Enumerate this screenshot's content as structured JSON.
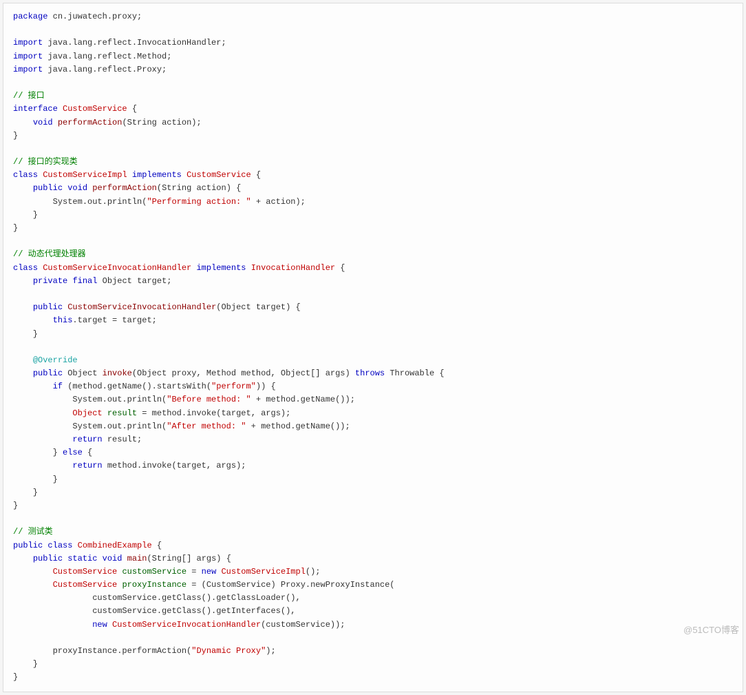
{
  "watermark": "@51CTO博客",
  "code": {
    "tokens": [
      [
        [
          "kw",
          "package"
        ],
        [
          "p",
          " cn.juwatech.proxy;"
        ]
      ],
      [
        [
          "p",
          ""
        ]
      ],
      [
        [
          "kw",
          "import"
        ],
        [
          "p",
          " java.lang.reflect.InvocationHandler;"
        ]
      ],
      [
        [
          "kw",
          "import"
        ],
        [
          "p",
          " java.lang.reflect.Method;"
        ]
      ],
      [
        [
          "kw",
          "import"
        ],
        [
          "p",
          " java.lang.reflect.Proxy;"
        ]
      ],
      [
        [
          "p",
          ""
        ]
      ],
      [
        [
          "cmt",
          "// 接口"
        ]
      ],
      [
        [
          "kw",
          "interface"
        ],
        [
          "p",
          " "
        ],
        [
          "type",
          "CustomService"
        ],
        [
          "p",
          " {"
        ]
      ],
      [
        [
          "p",
          "    "
        ],
        [
          "kw",
          "void"
        ],
        [
          "p",
          " "
        ],
        [
          "mname",
          "performAction"
        ],
        [
          "p",
          "(String action);"
        ]
      ],
      [
        [
          "p",
          "}"
        ]
      ],
      [
        [
          "p",
          ""
        ]
      ],
      [
        [
          "cmt",
          "// 接口的实现类"
        ]
      ],
      [
        [
          "kw",
          "class"
        ],
        [
          "p",
          " "
        ],
        [
          "type",
          "CustomServiceImpl"
        ],
        [
          "p",
          " "
        ],
        [
          "kw",
          "implements"
        ],
        [
          "p",
          " "
        ],
        [
          "type",
          "CustomService"
        ],
        [
          "p",
          " {"
        ]
      ],
      [
        [
          "p",
          "    "
        ],
        [
          "kw",
          "public"
        ],
        [
          "p",
          " "
        ],
        [
          "kw",
          "void"
        ],
        [
          "p",
          " "
        ],
        [
          "mname",
          "performAction"
        ],
        [
          "p",
          "(String action) {"
        ]
      ],
      [
        [
          "p",
          "        System.out.println("
        ],
        [
          "str",
          "\"Performing action: \""
        ],
        [
          "p",
          " + action);"
        ]
      ],
      [
        [
          "p",
          "    }"
        ]
      ],
      [
        [
          "p",
          "}"
        ]
      ],
      [
        [
          "p",
          ""
        ]
      ],
      [
        [
          "cmt",
          "// 动态代理处理器"
        ]
      ],
      [
        [
          "kw",
          "class"
        ],
        [
          "p",
          " "
        ],
        [
          "type",
          "CustomServiceInvocationHandler"
        ],
        [
          "p",
          " "
        ],
        [
          "kw",
          "implements"
        ],
        [
          "p",
          " "
        ],
        [
          "type",
          "InvocationHandler"
        ],
        [
          "p",
          " {"
        ]
      ],
      [
        [
          "p",
          "    "
        ],
        [
          "kw",
          "private"
        ],
        [
          "p",
          " "
        ],
        [
          "kw",
          "final"
        ],
        [
          "p",
          " Object target;"
        ]
      ],
      [
        [
          "p",
          ""
        ]
      ],
      [
        [
          "p",
          "    "
        ],
        [
          "kw",
          "public"
        ],
        [
          "p",
          " "
        ],
        [
          "mname",
          "CustomServiceInvocationHandler"
        ],
        [
          "p",
          "(Object target) {"
        ]
      ],
      [
        [
          "p",
          "        "
        ],
        [
          "kw",
          "this"
        ],
        [
          "p",
          ".target = target;"
        ]
      ],
      [
        [
          "p",
          "    }"
        ]
      ],
      [
        [
          "p",
          ""
        ]
      ],
      [
        [
          "p",
          "    "
        ],
        [
          "ann",
          "@Override"
        ]
      ],
      [
        [
          "p",
          "    "
        ],
        [
          "kw",
          "public"
        ],
        [
          "p",
          " Object "
        ],
        [
          "mname",
          "invoke"
        ],
        [
          "p",
          "(Object proxy, Method method, Object[] args) "
        ],
        [
          "kw",
          "throws"
        ],
        [
          "p",
          " Throwable {"
        ]
      ],
      [
        [
          "p",
          "        "
        ],
        [
          "kw",
          "if"
        ],
        [
          "p",
          " (method.getName().startsWith("
        ],
        [
          "str",
          "\"perform\""
        ],
        [
          "p",
          ")) {"
        ]
      ],
      [
        [
          "p",
          "            System.out.println("
        ],
        [
          "str",
          "\"Before method: \""
        ],
        [
          "p",
          " + method.getName());"
        ]
      ],
      [
        [
          "p",
          "            "
        ],
        [
          "type",
          "Object"
        ],
        [
          "p",
          " "
        ],
        [
          "vname",
          "result"
        ],
        [
          "p",
          " = method.invoke(target, args);"
        ]
      ],
      [
        [
          "p",
          "            System.out.println("
        ],
        [
          "str",
          "\"After method: \""
        ],
        [
          "p",
          " + method.getName());"
        ]
      ],
      [
        [
          "p",
          "            "
        ],
        [
          "kw",
          "return"
        ],
        [
          "p",
          " result;"
        ]
      ],
      [
        [
          "p",
          "        } "
        ],
        [
          "kw",
          "else"
        ],
        [
          "p",
          " {"
        ]
      ],
      [
        [
          "p",
          "            "
        ],
        [
          "kw",
          "return"
        ],
        [
          "p",
          " method.invoke(target, args);"
        ]
      ],
      [
        [
          "p",
          "        }"
        ]
      ],
      [
        [
          "p",
          "    }"
        ]
      ],
      [
        [
          "p",
          "}"
        ]
      ],
      [
        [
          "p",
          ""
        ]
      ],
      [
        [
          "cmt",
          "// 测试类"
        ]
      ],
      [
        [
          "kw",
          "public"
        ],
        [
          "p",
          " "
        ],
        [
          "kw",
          "class"
        ],
        [
          "p",
          " "
        ],
        [
          "type",
          "CombinedExample"
        ],
        [
          "p",
          " {"
        ]
      ],
      [
        [
          "p",
          "    "
        ],
        [
          "kw",
          "public"
        ],
        [
          "p",
          " "
        ],
        [
          "kw",
          "static"
        ],
        [
          "p",
          " "
        ],
        [
          "kw",
          "void"
        ],
        [
          "p",
          " "
        ],
        [
          "mname",
          "main"
        ],
        [
          "p",
          "(String[] args) {"
        ]
      ],
      [
        [
          "p",
          "        "
        ],
        [
          "type",
          "CustomService"
        ],
        [
          "p",
          " "
        ],
        [
          "vname",
          "customService"
        ],
        [
          "p",
          " = "
        ],
        [
          "kw",
          "new"
        ],
        [
          "p",
          " "
        ],
        [
          "type",
          "CustomServiceImpl"
        ],
        [
          "p",
          "();"
        ]
      ],
      [
        [
          "p",
          "        "
        ],
        [
          "type",
          "CustomService"
        ],
        [
          "p",
          " "
        ],
        [
          "vname",
          "proxyInstance"
        ],
        [
          "p",
          " = (CustomService) Proxy.newProxyInstance("
        ]
      ],
      [
        [
          "p",
          "                customService.getClass().getClassLoader(),"
        ]
      ],
      [
        [
          "p",
          "                customService.getClass().getInterfaces(),"
        ]
      ],
      [
        [
          "p",
          "                "
        ],
        [
          "kw",
          "new"
        ],
        [
          "p",
          " "
        ],
        [
          "type",
          "CustomServiceInvocationHandler"
        ],
        [
          "p",
          "(customService));"
        ]
      ],
      [
        [
          "p",
          ""
        ]
      ],
      [
        [
          "p",
          "        proxyInstance.performAction("
        ],
        [
          "str",
          "\"Dynamic Proxy\""
        ],
        [
          "p",
          ");"
        ]
      ],
      [
        [
          "p",
          "    }"
        ]
      ],
      [
        [
          "p",
          "}"
        ]
      ]
    ]
  }
}
